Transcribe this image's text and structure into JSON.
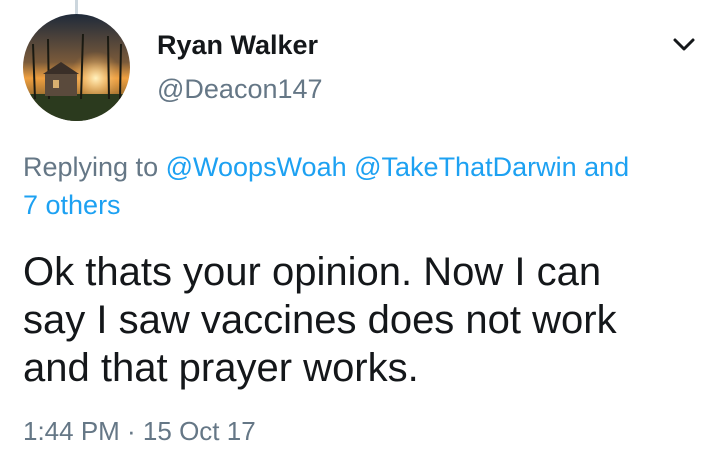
{
  "tweet": {
    "author": {
      "display_name": "Ryan Walker",
      "handle": "@Deacon147",
      "avatar_description": "cabin-in-woods-sunset-photo"
    },
    "menu_icon": "chevron-down-icon",
    "reply_context": {
      "prefix": "Replying to",
      "mentions": [
        "@WoopsWoah",
        "@TakeThatDarwin"
      ],
      "conjunction": "and",
      "others": "7 others"
    },
    "text_lines": [
      "Ok thats your opinion. Now I can",
      "say I saw vaccines does not work",
      "and that prayer works."
    ],
    "timestamp": "1:44 PM · 15 Oct 17"
  },
  "colors": {
    "primary_text": "#14171a",
    "secondary_text": "#657786",
    "link": "#1da1f2",
    "thread_line": "#ccd6dd"
  }
}
